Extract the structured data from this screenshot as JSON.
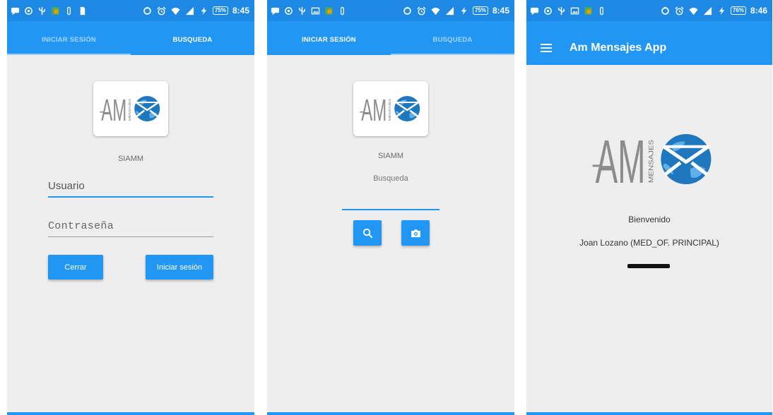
{
  "colors": {
    "primary": "#2196f3",
    "status_bar": "#1e88e5",
    "screen_background": "#eeeeee",
    "text": "#333333"
  },
  "logo": {
    "letters": "AM",
    "tagline": "MENSAJES"
  },
  "screens": {
    "login": {
      "status_bar": {
        "left_icons": [
          "chat-icon",
          "whatsapp-icon",
          "usb-icon",
          "photo-icon",
          "clip-icon",
          "sim-icon"
        ],
        "right_icons": [
          "sync-icon",
          "alarm-icon",
          "wifi-icon",
          "signal-icon",
          "charging-icon"
        ],
        "battery": "75%",
        "time": "8:45"
      },
      "tabs": [
        {
          "label": "INICIAR SESIÓN",
          "active": false
        },
        {
          "label": "BUSQUEDA",
          "active": true
        }
      ],
      "app_name": "SIAMM",
      "username_field": {
        "placeholder": "Usuario",
        "value": ""
      },
      "password_field": {
        "placeholder": "Contraseña",
        "value": ""
      },
      "close_button": "Cerrar",
      "login_button": "Iniciar sesión"
    },
    "search": {
      "status_bar": {
        "left_icons": [
          "chat-icon",
          "whatsapp-icon",
          "usb-icon",
          "image-icon",
          "photo-icon",
          "clip-icon"
        ],
        "right_icons": [
          "sync-icon",
          "alarm-icon",
          "wifi-icon",
          "signal-icon",
          "charging-icon"
        ],
        "battery": "75%",
        "time": "8:45"
      },
      "tabs": [
        {
          "label": "INICIAR SESIÓN",
          "active": true
        },
        {
          "label": "BUSQUEDA",
          "active": false
        }
      ],
      "app_name": "SIAMM",
      "subtitle": "Busqueda",
      "search_field": {
        "value": ""
      },
      "search_button_icon": "search-icon",
      "camera_button_icon": "camera-icon"
    },
    "home": {
      "status_bar": {
        "left_icons": [
          "chat-icon",
          "whatsapp-icon",
          "usb-icon",
          "image-icon",
          "photo-icon",
          "clip-icon"
        ],
        "right_icons": [
          "sync-icon",
          "alarm-icon",
          "wifi-icon",
          "signal-icon",
          "charging-icon"
        ],
        "battery": "76%",
        "time": "8:46"
      },
      "toolbar": {
        "menu_icon": "menu-icon",
        "title": "Am Mensajes App"
      },
      "welcome": "Bienvenido",
      "user_name": "Joan Lozano (MED_OF. PRINCIPAL)"
    }
  }
}
